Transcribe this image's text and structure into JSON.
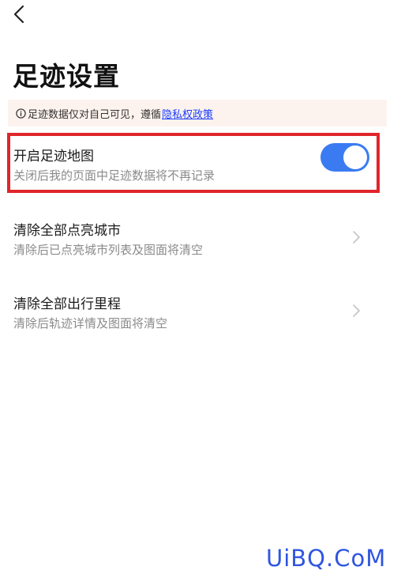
{
  "header": {
    "back_icon": "chevron-left-icon",
    "title": "足迹设置"
  },
  "notice": {
    "icon": "info-circle-icon",
    "text": "足迹数据仅对自己可见，遵循",
    "link": "隐私权政策"
  },
  "settings": [
    {
      "title": "开启足迹地图",
      "desc": "关闭后我的页面中足迹数据将不再记录",
      "control": "toggle",
      "enabled": true
    },
    {
      "title": "清除全部点亮城市",
      "desc": "清除后已点亮城市列表及图面将清空",
      "control": "chevron-right-icon"
    },
    {
      "title": "清除全部出行里程",
      "desc": "清除后轨迹详情及图面将清空",
      "control": "chevron-right-icon"
    }
  ],
  "colors": {
    "accent": "#3a7bf2",
    "highlight": "#e0252b",
    "notice_bg": "#fdf3ee",
    "link": "#1a3cff"
  },
  "watermark": "UiBQ.CoM"
}
